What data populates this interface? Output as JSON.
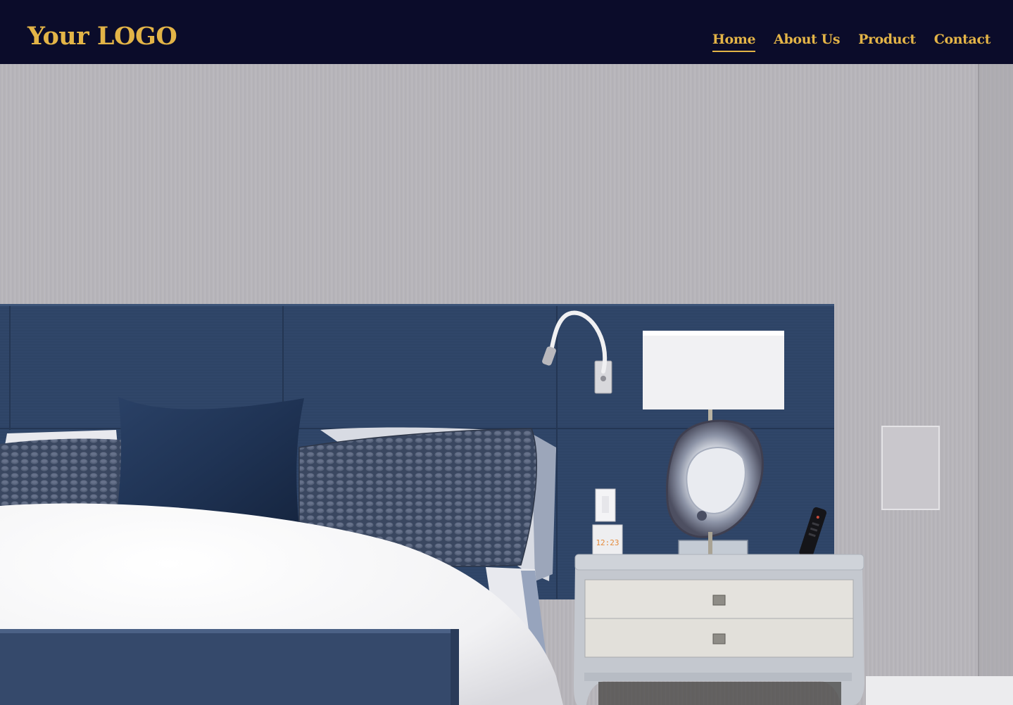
{
  "header": {
    "logo": "Your LOGO",
    "nav": [
      {
        "label": "Home",
        "active": true
      },
      {
        "label": "About Us",
        "active": false
      },
      {
        "label": "Product",
        "active": false
      },
      {
        "label": "Contact",
        "active": false
      }
    ]
  },
  "hero": {
    "alarm_clock_display": "12:23"
  },
  "colors": {
    "header_bg": "#0b0c2a",
    "accent": "#e3b447",
    "headboard": "#2e4466",
    "wall": "#b8b6ba"
  }
}
